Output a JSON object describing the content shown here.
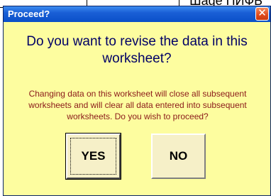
{
  "background": {
    "partial_text": "Шаge   ПИФБ"
  },
  "dialog": {
    "title": "Proceed?",
    "close_glyph": "✕",
    "question": "Do you want to revise the data in this worksheet?",
    "explanation": "Changing data on this worksheet will close all subsequent worksheets and will clear all data entered into subsequent worksheets.  Do you wish to proceed?",
    "yes_label": "YES",
    "no_label": "NO"
  },
  "colors": {
    "dialog_background": "#fdfd9f",
    "titlebar": "#1a5fd6",
    "question_text": "#000066",
    "explanation_text": "#8b1a1a",
    "close_button": "#e0491b"
  }
}
